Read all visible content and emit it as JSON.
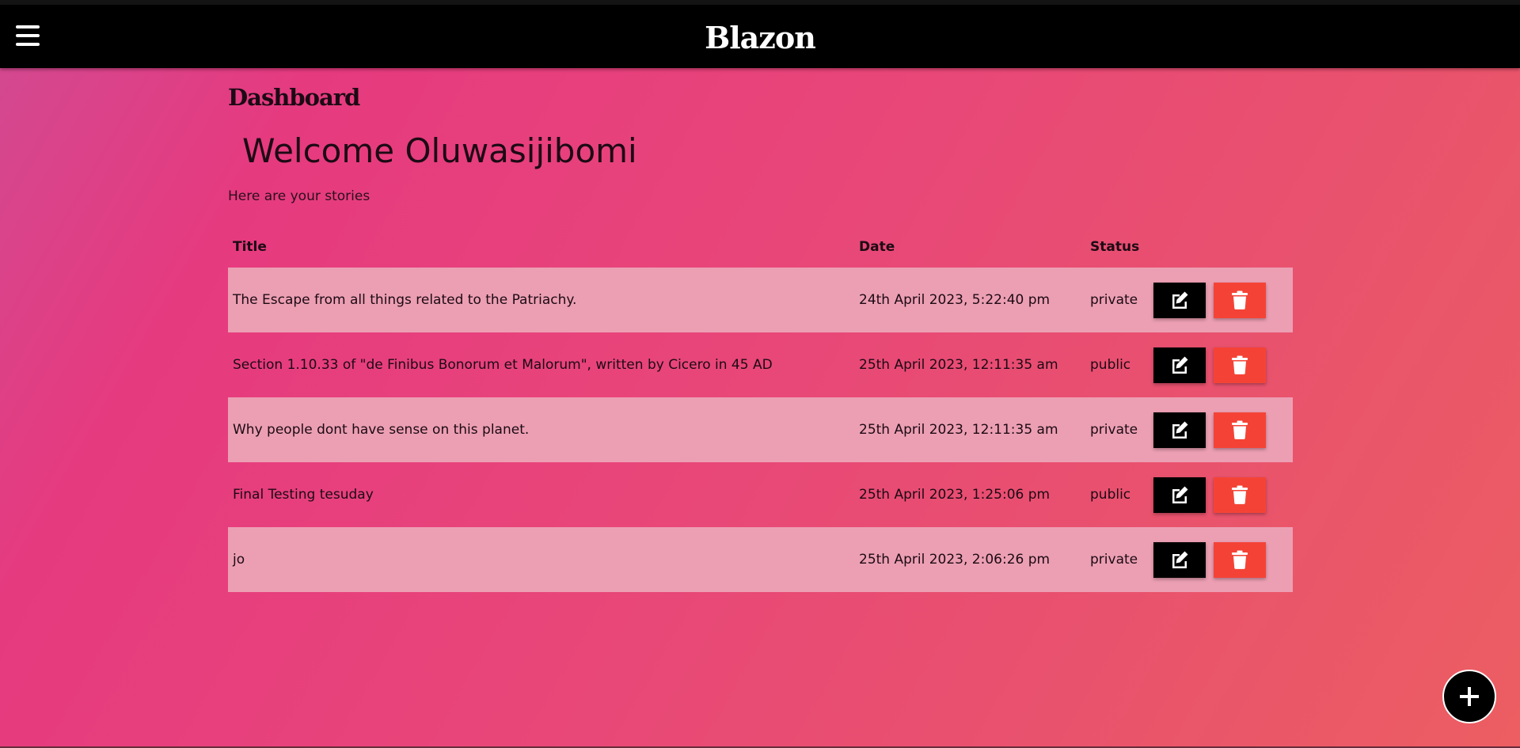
{
  "app": {
    "brand": "Blazon"
  },
  "header": {
    "menu_icon": "hamburger-menu-icon"
  },
  "main": {
    "dashboard_title": "Dashboard",
    "welcome": "Welcome Oluwasijibomi",
    "subtitle": "Here are your stories"
  },
  "table": {
    "columns": [
      "Title",
      "Date",
      "Status"
    ],
    "rows": [
      {
        "title": "The Escape from all things related to the Patriachy.",
        "date": "24th April 2023, 5:22:40 pm",
        "status": "private"
      },
      {
        "title": "Section 1.10.33 of \"de Finibus Bonorum et Malorum\", written by Cicero in 45 AD",
        "date": "25th April 2023, 12:11:35 am",
        "status": "public"
      },
      {
        "title": "Why people dont have sense on this planet.",
        "date": "25th April 2023, 12:11:35 am",
        "status": "private"
      },
      {
        "title": "Final Testing tesuday",
        "date": "25th April 2023, 1:25:06 pm",
        "status": "public"
      },
      {
        "title": "jo",
        "date": "25th April 2023, 2:06:26 pm",
        "status": "private"
      }
    ],
    "edit_icon": "edit-icon",
    "delete_icon": "trash-icon"
  },
  "fab": {
    "icon": "plus-icon"
  },
  "colors": {
    "navbar": "#000000",
    "row_highlight": "#ec9fb3",
    "edit_button": "#000000",
    "delete_button": "#f44336",
    "gradient_start": "#d14a92",
    "gradient_end": "#ec5e62"
  }
}
